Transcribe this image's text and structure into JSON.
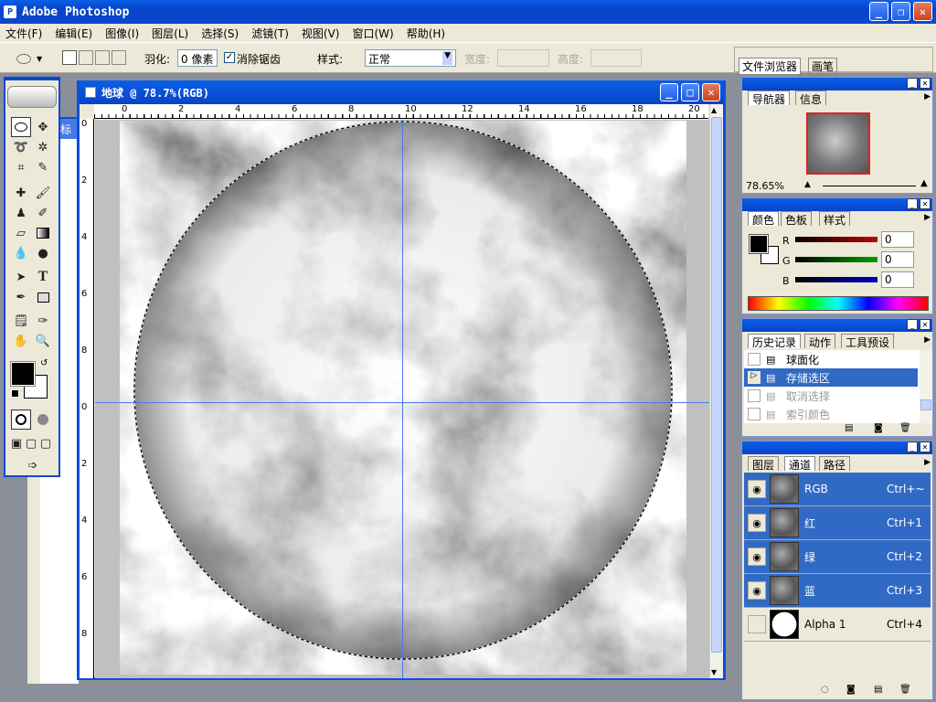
{
  "app": {
    "title": "Adobe Photoshop",
    "icon": "photoshop-icon"
  },
  "menu": [
    "文件(F)",
    "编辑(E)",
    "图像(I)",
    "图层(L)",
    "选择(S)",
    "滤镜(T)",
    "视图(V)",
    "窗口(W)",
    "帮助(H)"
  ],
  "options": {
    "feather_label": "羽化:",
    "feather_value": "0 像素",
    "antialias_label": "消除锯齿",
    "antialias_checked": true,
    "style_label": "样式:",
    "style_value": "正常",
    "width_label": "宽度:",
    "height_label": "高度:"
  },
  "palette_well": {
    "tabs": [
      "文件浏览器",
      "画笔"
    ]
  },
  "document": {
    "title": "地球 @ 78.7%(RGB)",
    "ruler_h": [
      "0",
      "2",
      "4",
      "6",
      "8",
      "10",
      "12",
      "14",
      "16",
      "18",
      "20"
    ],
    "ruler_v": [
      "0",
      "2",
      "4",
      "6",
      "8",
      "0",
      "2",
      "4",
      "6",
      "8"
    ],
    "bg_tab": "标"
  },
  "navigator": {
    "tabs": [
      "导航器",
      "信息"
    ],
    "zoom": "78.65%"
  },
  "color": {
    "tabs": [
      "颜色",
      "色板",
      "样式"
    ],
    "channels": [
      {
        "label": "R",
        "value": "0",
        "color": "#c00000"
      },
      {
        "label": "G",
        "value": "0",
        "color": "#00a000"
      },
      {
        "label": "B",
        "value": "0",
        "color": "#0000c0"
      }
    ]
  },
  "history": {
    "tabs": [
      "历史记录",
      "动作",
      "工具预设"
    ],
    "items": [
      {
        "label": "球面化",
        "state": "normal"
      },
      {
        "label": "存储选区",
        "state": "selected"
      },
      {
        "label": "取消选择",
        "state": "dimmed"
      },
      {
        "label": "索引颜色",
        "state": "dimmed"
      }
    ]
  },
  "channels": {
    "tabs": [
      "图层",
      "通道",
      "路径"
    ],
    "items": [
      {
        "name": "RGB",
        "shortcut": "Ctrl+~",
        "visible": true
      },
      {
        "name": "红",
        "shortcut": "Ctrl+1",
        "visible": true
      },
      {
        "name": "绿",
        "shortcut": "Ctrl+2",
        "visible": true
      },
      {
        "name": "蓝",
        "shortcut": "Ctrl+3",
        "visible": true
      },
      {
        "name": "Alpha 1",
        "shortcut": "Ctrl+4",
        "visible": false
      }
    ]
  }
}
